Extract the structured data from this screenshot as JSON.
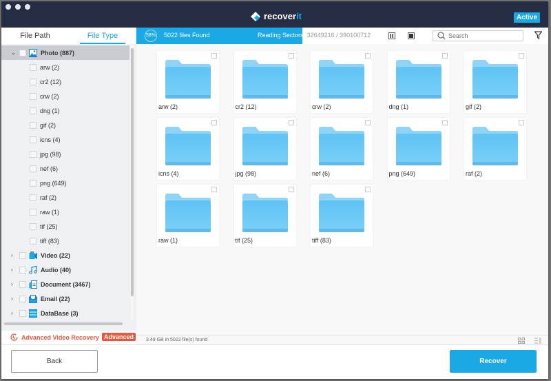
{
  "window": {
    "app_name_prefix": "recover",
    "app_name_suffix": "it",
    "status_badge": "Active",
    "accent": "#1aa9e4",
    "titlebar_color": "#252d45"
  },
  "sidebar": {
    "tabs": [
      {
        "label": "File Path",
        "active": false
      },
      {
        "label": "File Type",
        "active": true
      }
    ],
    "categories": [
      {
        "label": "Photo (887)",
        "icon": "photo-icon",
        "expanded": true,
        "children": [
          "arw (2)",
          "cr2 (12)",
          "crw (2)",
          "dng (1)",
          "gif (2)",
          "icns (4)",
          "jpg (98)",
          "nef (6)",
          "png (649)",
          "raf (2)",
          "raw (1)",
          "tif (25)",
          "tiff (83)"
        ]
      },
      {
        "label": "Video (22)",
        "icon": "video-icon",
        "expanded": false
      },
      {
        "label": "Audio (40)",
        "icon": "audio-icon",
        "expanded": false
      },
      {
        "label": "Document (3467)",
        "icon": "document-icon",
        "expanded": false
      },
      {
        "label": "Email (22)",
        "icon": "email-icon",
        "expanded": false
      },
      {
        "label": "DataBase (3)",
        "icon": "database-icon",
        "expanded": false
      }
    ],
    "advanced_video": {
      "label": "Advanced Video Recovery",
      "badge": "Advanced",
      "color": "#e9573e"
    }
  },
  "scan": {
    "percent_label": "58%",
    "progress": 0.58,
    "files_found": "5022 files Found",
    "sectors_label": "Reading Sectors:",
    "sectors_value": "32649216 / 390100712"
  },
  "search": {
    "placeholder": "Search",
    "value": ""
  },
  "folders": [
    "arw (2)",
    "cr2 (12)",
    "crw (2)",
    "dng (1)",
    "gif (2)",
    "icns (4)",
    "jpg (98)",
    "nef (6)",
    "png (649)",
    "raf (2)",
    "raw (1)",
    "tif (25)",
    "tiff (83)"
  ],
  "status": {
    "summary": "3.49 GB in 5022 file(s) found"
  },
  "footer": {
    "back_label": "Back",
    "recover_label": "Recover"
  }
}
